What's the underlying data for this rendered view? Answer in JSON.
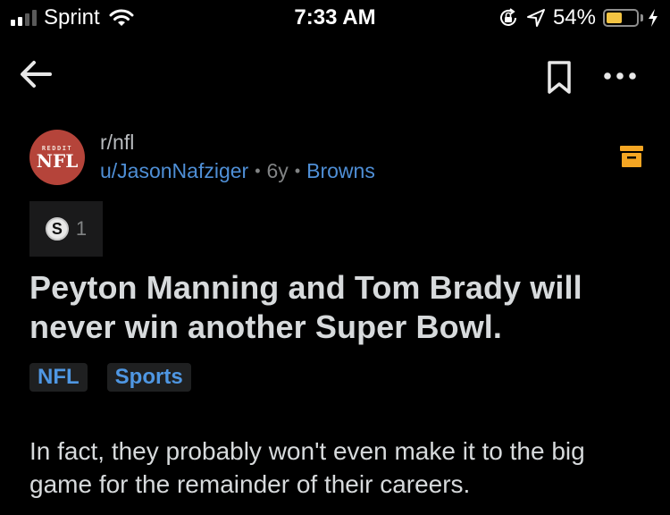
{
  "status_bar": {
    "carrier": "Sprint",
    "time": "7:33 AM",
    "battery_percent_label": "54%",
    "battery_level": 0.54,
    "signal_bars_active": 2,
    "signal_bars_total": 4,
    "icons": [
      "signal-icon",
      "wifi-icon",
      "orientation-lock-icon",
      "location-icon",
      "battery-icon",
      "charging-icon"
    ]
  },
  "nav": {
    "back_icon": "arrow-left-icon",
    "bookmark_icon": "bookmark-icon",
    "more_icon": "more-horizontal-icon"
  },
  "post": {
    "subreddit": "r/nfl",
    "subreddit_avatar": {
      "top_text": "REDDIT",
      "main_text": "NFL",
      "color": "#b5443a"
    },
    "author": "u/JasonNafziger",
    "separator": "•",
    "age": "6y",
    "author_flair": "Browns",
    "archived_icon": "archive-icon",
    "archived_color": "#f5a623",
    "award": {
      "icon": "silver-award-icon",
      "count": "1"
    },
    "title": "Peyton Manning and Tom Brady will never win another Super Bowl.",
    "tags": [
      {
        "label": "NFL"
      },
      {
        "label": "Sports"
      }
    ],
    "body": "In fact, they probably won't even make it to the big game for the remainder of their careers."
  },
  "colors": {
    "background": "#000000",
    "link_blue": "#4f8fd6",
    "text_primary": "#d7dadc",
    "text_muted": "#818384"
  }
}
